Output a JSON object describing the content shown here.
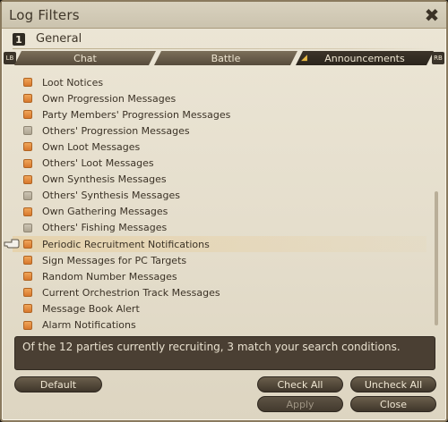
{
  "window": {
    "title": "Log Filters"
  },
  "set": {
    "number": "1",
    "name": "General"
  },
  "shoulders": {
    "left": "LB",
    "right": "RB"
  },
  "tabs": [
    {
      "label": "Chat",
      "active": false
    },
    {
      "label": "Battle",
      "active": false
    },
    {
      "label": "Announcements",
      "active": true
    }
  ],
  "filters": [
    {
      "label": "Loot Notices",
      "checked": true
    },
    {
      "label": "Own Progression Messages",
      "checked": true
    },
    {
      "label": "Party Members' Progression Messages",
      "checked": true
    },
    {
      "label": "Others' Progression Messages",
      "checked": false
    },
    {
      "label": "Own Loot Messages",
      "checked": true
    },
    {
      "label": "Others' Loot Messages",
      "checked": true
    },
    {
      "label": "Own Synthesis Messages",
      "checked": true
    },
    {
      "label": "Others' Synthesis Messages",
      "checked": false
    },
    {
      "label": "Own Gathering Messages",
      "checked": true
    },
    {
      "label": "Others' Fishing Messages",
      "checked": false
    },
    {
      "label": "Periodic Recruitment Notifications",
      "checked": true
    },
    {
      "label": "Sign Messages for PC Targets",
      "checked": true
    },
    {
      "label": "Random Number Messages",
      "checked": true
    },
    {
      "label": "Current Orchestrion Track Messages",
      "checked": true
    },
    {
      "label": "Message Book Alert",
      "checked": true
    },
    {
      "label": "Alarm Notifications",
      "checked": true
    }
  ],
  "message": "Of the 12 parties currently recruiting, 3 match your search conditions.",
  "buttons": {
    "default": "Default",
    "check_all": "Check All",
    "uncheck_all": "Uncheck All",
    "apply": "Apply",
    "close": "Close"
  },
  "colors": {
    "checked": "#e48a3a",
    "unchecked": "#b8b09e",
    "panel": "#e8e1cf",
    "message_bg": "#4a3f33"
  }
}
